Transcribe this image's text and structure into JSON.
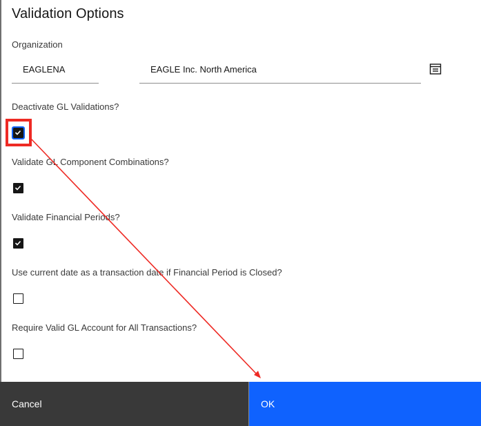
{
  "dialog": {
    "title": "Validation Options"
  },
  "organization": {
    "label": "Organization",
    "code": "EAGLENA",
    "name": "EAGLE Inc. North America",
    "lookup_icon": "list-lookup-icon"
  },
  "options": [
    {
      "label": "Deactivate GL Validations?",
      "checked": true
    },
    {
      "label": "Validate GL Component Combinations?",
      "checked": true
    },
    {
      "label": "Validate Financial Periods?",
      "checked": true
    },
    {
      "label": "Use current date as a transaction date if Financial Period is Closed?",
      "checked": false
    },
    {
      "label": "Require Valid GL Account for All Transactions?",
      "checked": false
    }
  ],
  "footer": {
    "cancel_label": "Cancel",
    "ok_label": "OK"
  },
  "colors": {
    "primary": "#0f62fe",
    "secondary_button": "#393939",
    "annotation": "#ee2a24"
  }
}
